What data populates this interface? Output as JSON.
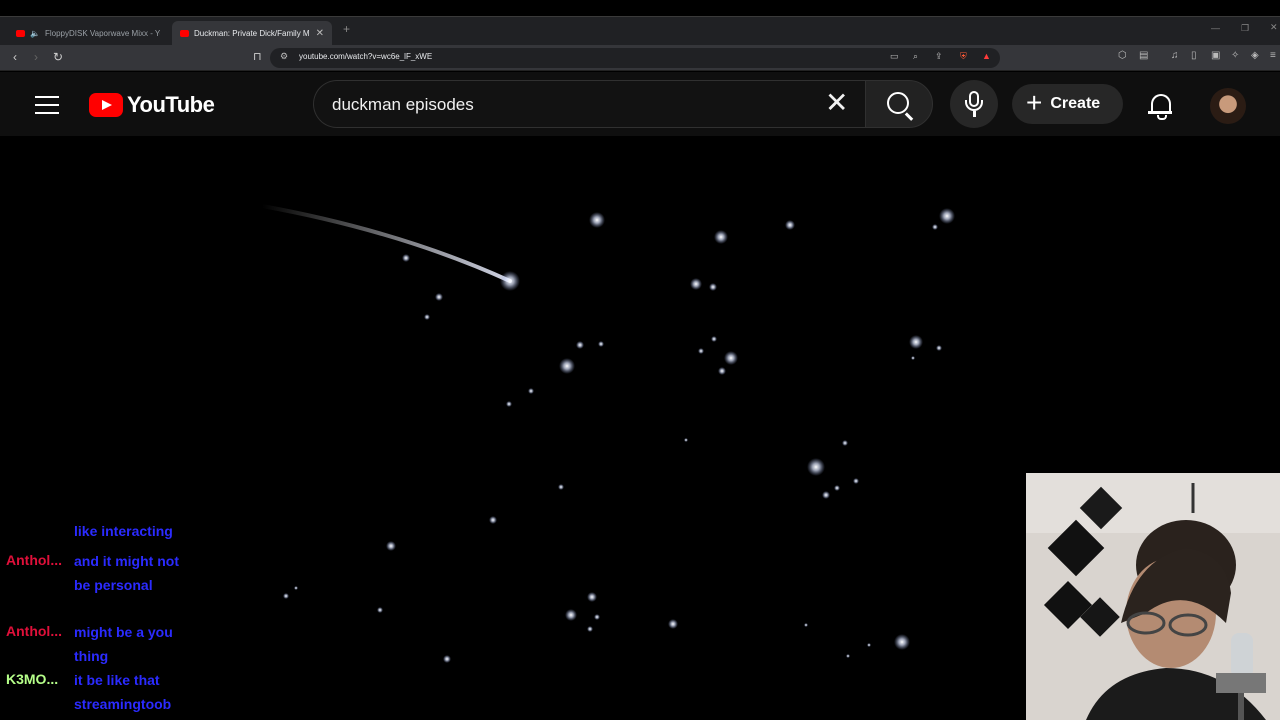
{
  "browser": {
    "tabs": [
      {
        "title": "FloppyDISK Vaporwave Mixx - Yo",
        "active": false,
        "audio": true
      },
      {
        "title": "Duckman: Private Dick/Family M",
        "active": true,
        "audio": false
      }
    ],
    "url": "youtube.com/watch?v=wc6e_lF_xWE"
  },
  "youtube": {
    "logo_text": "YouTube",
    "search_query": "duckman episodes",
    "create_label": "Create"
  },
  "chat": {
    "messages": [
      {
        "user": "",
        "user_color": "#e0103a",
        "text": "like interacting"
      },
      {
        "user": "Anthol...",
        "user_color": "#e0103a",
        "text": "and it might not be personal"
      },
      {
        "user": "Anthol...",
        "user_color": "#e0103a",
        "text": "might be a you thing"
      },
      {
        "user": "K3MO...",
        "user_color": "#b6ff8a",
        "text": "it be like that streamingtoob"
      }
    ]
  },
  "colors": {
    "youtube_red": "#ff0000",
    "header_bg": "#0f0f0f",
    "chat_text": "#2b2bff"
  }
}
